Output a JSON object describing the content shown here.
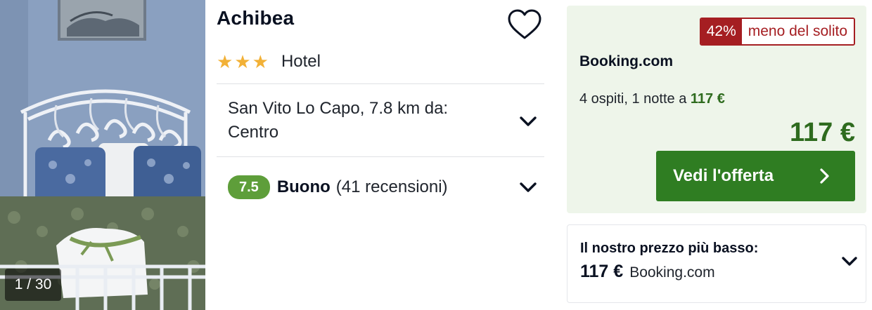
{
  "photo": {
    "counter": "1 / 30",
    "accent_colors": {
      "wall": "#8aa0c0",
      "bedspread": "#5f6e55",
      "pillow": "#3d5c8c"
    }
  },
  "hotel": {
    "name": "Achibea",
    "stars": 3,
    "type": "Hotel",
    "location": "San Vito Lo Capo, 7.8 km da: Centro",
    "rating": {
      "score": "7.5",
      "label": "Buono",
      "reviews": "(41 recensioni)"
    },
    "favorite_icon": "heart-outline-icon",
    "expand_icon": "chevron-down-icon"
  },
  "offer": {
    "discount_pct": "42%",
    "discount_text": "meno del solito",
    "provider": "Booking.com",
    "per_night_text": "4 ospiti, 1 notte a",
    "per_night_price": "117 €",
    "price": "117 €",
    "cta_label": "Vedi l'offerta",
    "cta_icon": "chevron-right-icon",
    "colors": {
      "price_green": "#2e6b1e",
      "cta_green": "#2f7d22",
      "discount_red": "#a51e22",
      "background": "#eef5ea",
      "rating_green": "#5e9e3a",
      "star": "#f2b137"
    }
  },
  "lowest_price": {
    "title": "Il nostro prezzo più basso:",
    "price": "117 €",
    "provider": "Booking.com"
  }
}
